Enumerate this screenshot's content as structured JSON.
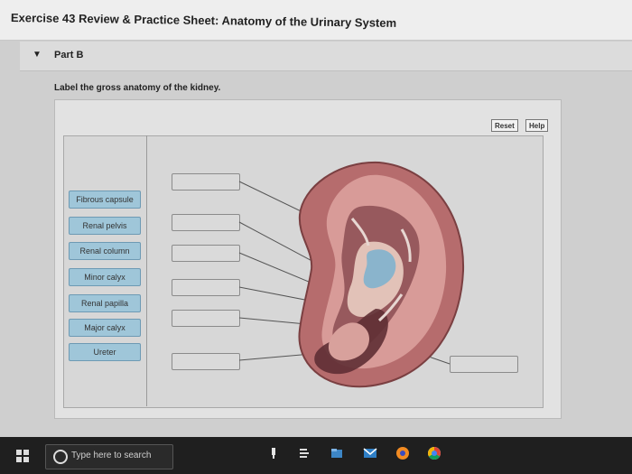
{
  "page": {
    "title": "Exercise 43 Review & Practice Sheet: Anatomy of the Urinary System",
    "part": "Part B",
    "instruction": "Label the gross anatomy of the kidney."
  },
  "buttons": {
    "reset": "Reset",
    "help": "Help"
  },
  "labels": [
    "Fibrous capsule",
    "Renal pelvis",
    "Renal column",
    "Minor calyx",
    "Renal papilla",
    "Major calyx",
    "Ureter"
  ],
  "taskbar": {
    "search_placeholder": "Type here to search"
  }
}
